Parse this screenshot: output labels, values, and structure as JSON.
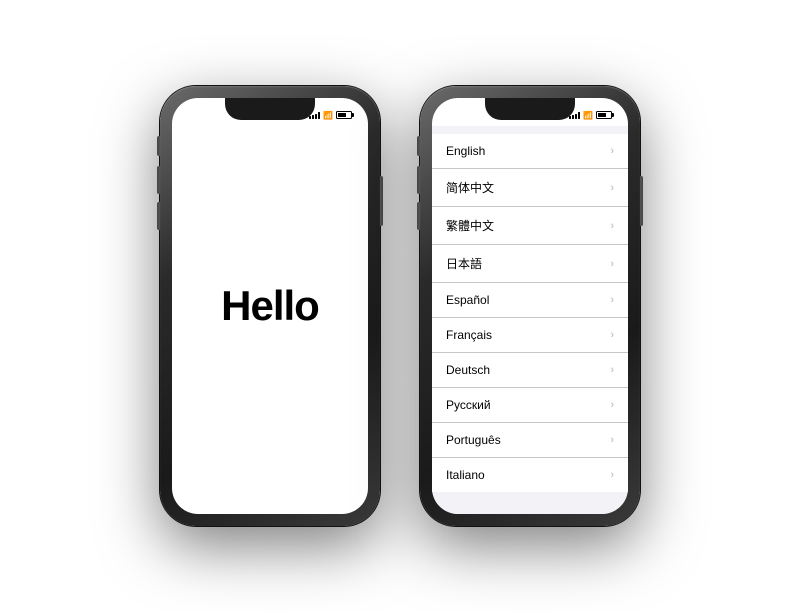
{
  "phone1": {
    "label": "hello-phone",
    "hello_text": "Hello"
  },
  "phone2": {
    "label": "language-phone",
    "languages": [
      {
        "name": "English",
        "id": "english"
      },
      {
        "name": "简体中文",
        "id": "simplified-chinese"
      },
      {
        "name": "繁體中文",
        "id": "traditional-chinese"
      },
      {
        "name": "日本語",
        "id": "japanese"
      },
      {
        "name": "Español",
        "id": "spanish"
      },
      {
        "name": "Français",
        "id": "french"
      },
      {
        "name": "Deutsch",
        "id": "german"
      },
      {
        "name": "Русский",
        "id": "russian"
      },
      {
        "name": "Português",
        "id": "portuguese"
      },
      {
        "name": "Italiano",
        "id": "italian"
      }
    ]
  }
}
